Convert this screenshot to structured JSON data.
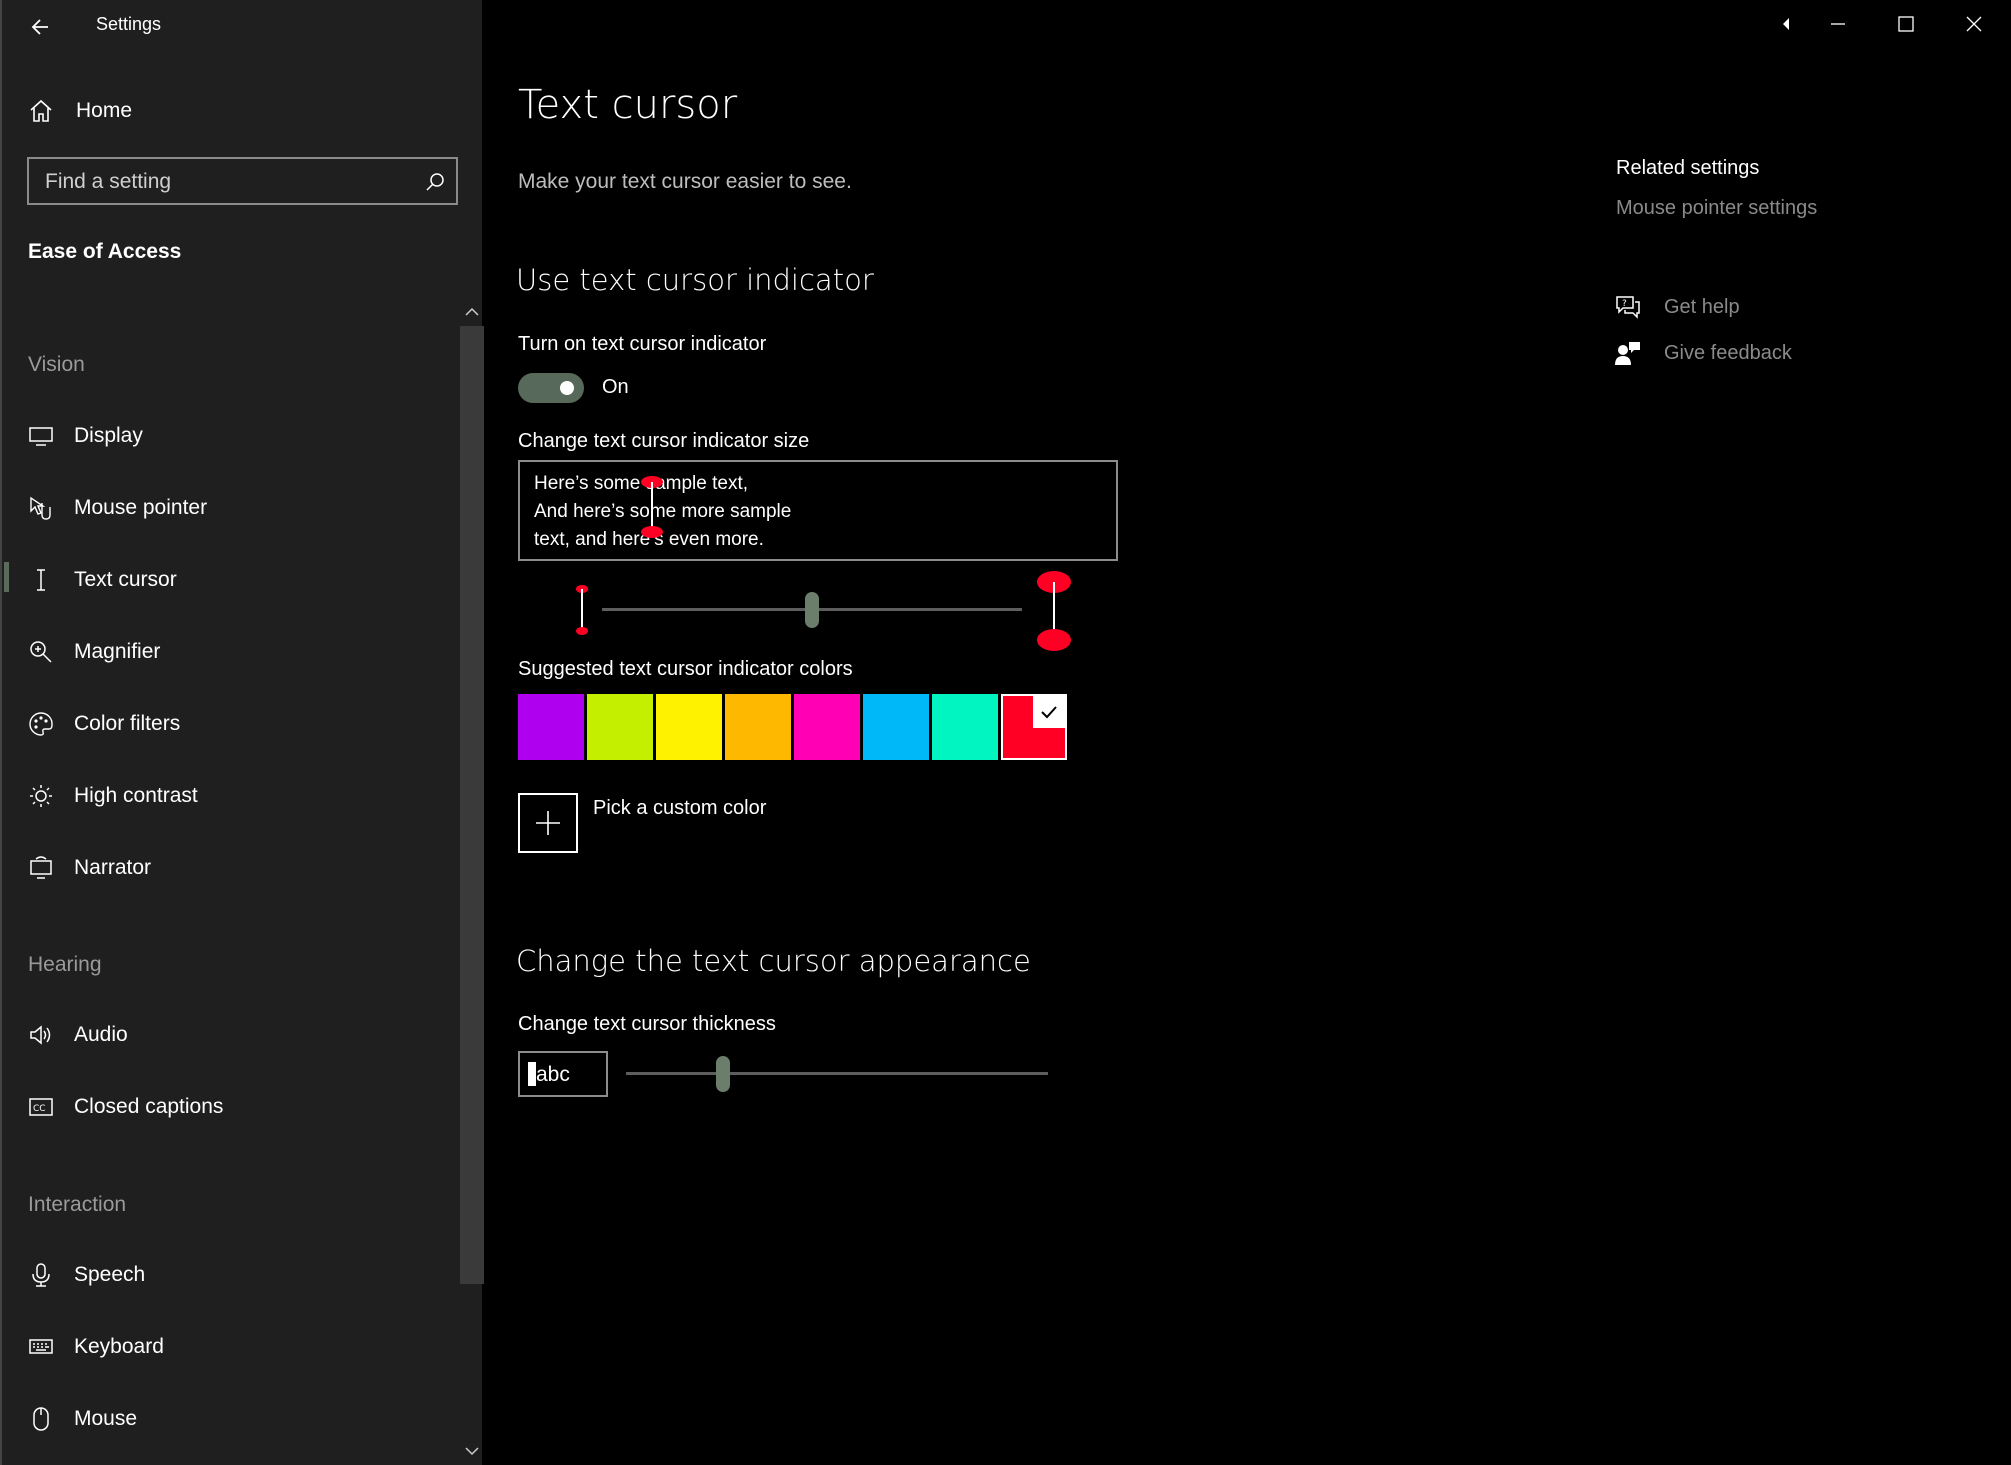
{
  "app": {
    "title": "Settings"
  },
  "sidebar": {
    "home_label": "Home",
    "search_placeholder": "Find a setting",
    "section_title": "Ease of Access",
    "groups": {
      "vision": {
        "header": "Vision",
        "items": [
          {
            "label": "Display",
            "icon": "monitor-icon"
          },
          {
            "label": "Mouse pointer",
            "icon": "mouse-pointer-icon"
          },
          {
            "label": "Text cursor",
            "icon": "text-cursor-icon",
            "selected": true
          },
          {
            "label": "Magnifier",
            "icon": "magnifier-icon"
          },
          {
            "label": "Color filters",
            "icon": "palette-icon"
          },
          {
            "label": "High contrast",
            "icon": "sun-icon"
          },
          {
            "label": "Narrator",
            "icon": "narrator-icon"
          }
        ]
      },
      "hearing": {
        "header": "Hearing",
        "items": [
          {
            "label": "Audio",
            "icon": "speaker-icon"
          },
          {
            "label": "Closed captions",
            "icon": "captions-icon"
          }
        ]
      },
      "interaction": {
        "header": "Interaction",
        "items": [
          {
            "label": "Speech",
            "icon": "microphone-icon"
          },
          {
            "label": "Keyboard",
            "icon": "keyboard-icon"
          },
          {
            "label": "Mouse",
            "icon": "mouse-icon"
          }
        ]
      }
    }
  },
  "main": {
    "title": "Text cursor",
    "description": "Make your text cursor easier to see.",
    "indicator_section": {
      "heading": "Use text cursor indicator",
      "toggle_label": "Turn on text cursor indicator",
      "toggle_state": "On",
      "toggle_on": true,
      "size_label": "Change text cursor indicator size",
      "sample_lines": [
        "Here’s some sample text,",
        "And here’s some more sample",
        "text, and here’s even more."
      ],
      "size_value_fraction": 0.5,
      "colors_label": "Suggested text cursor indicator colors",
      "colors": [
        "#B000F0",
        "#C4F000",
        "#FFF200",
        "#FFB800",
        "#FF00B4",
        "#00B8F8",
        "#00F5C0",
        "#FF0024"
      ],
      "selected_color": "#FF0024",
      "custom_color_label": "Pick a custom color"
    },
    "appearance_section": {
      "heading": "Change the text cursor appearance",
      "thickness_label": "Change text cursor thickness",
      "preview_text": "abc",
      "thickness_value_fraction": 0.22
    }
  },
  "related": {
    "title": "Related settings",
    "link": "Mouse pointer settings",
    "get_help": "Get help",
    "give_feedback": "Give feedback"
  }
}
